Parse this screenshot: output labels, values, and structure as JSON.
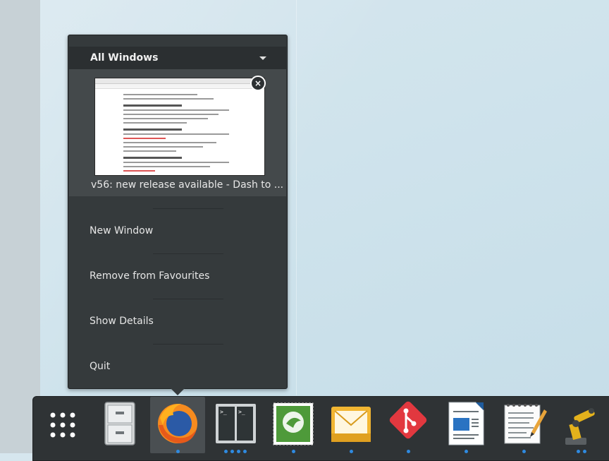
{
  "context_menu": {
    "header_label": "All Windows",
    "window_caption": "v56: new release available - Dash to ...",
    "close_glyph": "×",
    "items": [
      {
        "label": "New Window"
      },
      {
        "label": "Remove from Favourites"
      },
      {
        "label": "Show Details"
      },
      {
        "label": "Quit"
      }
    ]
  },
  "dock": {
    "items": [
      {
        "name": "show-apps",
        "icon": "grid-icon",
        "running_dots": 0
      },
      {
        "name": "files",
        "icon": "filing-cabinet-icon",
        "running_dots": 0
      },
      {
        "name": "firefox",
        "icon": "firefox-icon",
        "running_dots": 1,
        "active": true
      },
      {
        "name": "terminal",
        "icon": "terminal-icon",
        "running_dots": 4
      },
      {
        "name": "mail-stamp",
        "icon": "stamp-icon",
        "running_dots": 1
      },
      {
        "name": "mail",
        "icon": "envelope-icon",
        "running_dots": 1
      },
      {
        "name": "git",
        "icon": "git-icon",
        "running_dots": 1
      },
      {
        "name": "writer",
        "icon": "document-icon",
        "running_dots": 1
      },
      {
        "name": "text-editor",
        "icon": "notepad-icon",
        "running_dots": 1
      },
      {
        "name": "robot-arm",
        "icon": "robot-arm-icon",
        "running_dots": 2
      }
    ]
  },
  "colors": {
    "accent_dot": "#2f8ae0",
    "menu_bg": "#353a3c",
    "dock_bg": "#2f3335"
  }
}
